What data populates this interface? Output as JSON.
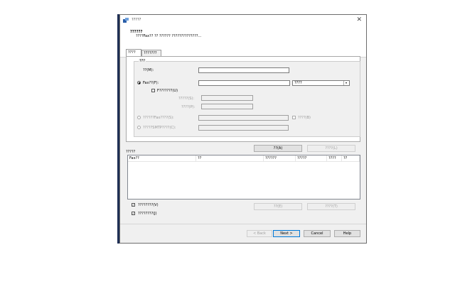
{
  "window": {
    "title": "?????",
    "close_glyph": "✕"
  },
  "header": {
    "title": "??????",
    "description": "????Fax?? ?? ?????? ??????????????..."
  },
  "tabs": [
    {
      "label": "????"
    },
    {
      "label": "???????"
    }
  ],
  "group": {
    "legend": "???",
    "name_label": "??(M):",
    "fax_radio_label": "Fax??(F):",
    "fax_select_value": "????",
    "f_checkbox_label": "F???????(U)",
    "sub_label_1": "?????(S):",
    "sub_label_2": "????(P):",
    "radio2_label": "??????Fax????(S):",
    "radio3_label": "?????SMTP????(C):",
    "right_checkbox_label": "????(B)"
  },
  "mid": {
    "add_button": "??(A)",
    "edit_button": "????(L)"
  },
  "list": {
    "section_label": "?????",
    "columns": [
      "Fax??",
      "??",
      "??????",
      "?????",
      "????",
      "??"
    ]
  },
  "bottom": {
    "checkbox1_label": "????????(V)",
    "checkbox2_label": "????????(J)",
    "btn_left": "??(E)",
    "btn_right": "????(T)"
  },
  "footer": {
    "back": "< Back",
    "next": "Next >",
    "cancel": "Cancel",
    "help": "Help"
  },
  "colors": {
    "accent": "#0078d7",
    "taskbar_strip": "#1f2f55"
  }
}
